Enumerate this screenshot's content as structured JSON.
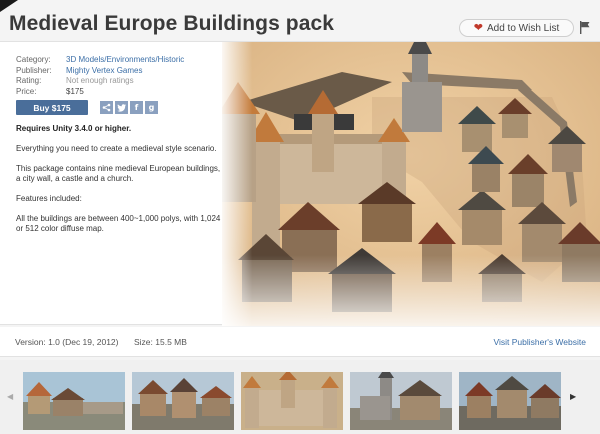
{
  "product": {
    "title": "Medieval Europe Buildings pack"
  },
  "actions": {
    "wishlist_label": "Add to Wish List"
  },
  "meta": {
    "category_label": "Category:",
    "category_value": "3D Models/Environments/Historic",
    "publisher_label": "Publisher:",
    "publisher_value": "Mighty Vertex Games",
    "rating_label": "Rating:",
    "rating_value": "Not enough ratings",
    "price_label": "Price:",
    "price_value": "$175"
  },
  "buy": {
    "label": "Buy $175"
  },
  "share": {
    "items": [
      "twitter-icon",
      "facebook-icon",
      "google-plus-icon"
    ]
  },
  "description": {
    "requirement": "Requires Unity 3.4.0 or higher.",
    "para1": "Everything you need to create a medieval style scenario.",
    "para2": "This package contains nine medieval European buildings, a city wall, a castle and a church.",
    "para3": "Features included:",
    "para4": "All the buildings are between 400~1,000 polys, with 1,024 or 512 color diffuse map."
  },
  "info": {
    "version": "Version: 1.0 (Dec 19, 2012)",
    "size": "Size: 15.5 MB",
    "publisher_link": "Visit Publisher's Website"
  },
  "gallery": {
    "thumb_count": 6
  },
  "colors": {
    "accent": "#4a6e9a",
    "link": "#3c6fa7",
    "heart": "#c0392b"
  }
}
